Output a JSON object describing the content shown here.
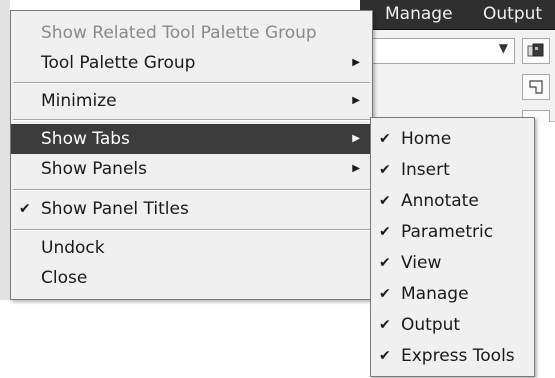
{
  "ribbon": {
    "tabs": [
      {
        "label": "Manage"
      },
      {
        "label": "Output"
      }
    ],
    "tool_icons": [
      "layers-icon",
      "corner-shape-icon",
      "tool-icon"
    ]
  },
  "menu": {
    "items": [
      {
        "label": "Show Related Tool Palette Group",
        "disabled": true
      },
      {
        "label": "Tool Palette Group",
        "has_submenu": true
      },
      {
        "label": "Minimize",
        "has_submenu": true
      },
      {
        "label": "Show Tabs",
        "has_submenu": true,
        "selected": true
      },
      {
        "label": "Show Panels",
        "has_submenu": true
      },
      {
        "label": "Show Panel Titles",
        "checked": true
      },
      {
        "label": "Undock"
      },
      {
        "label": "Close"
      }
    ],
    "check_glyph": "✔",
    "submenu_arrow_glyph": "▶"
  },
  "submenu": {
    "items": [
      {
        "label": "Home",
        "checked": true
      },
      {
        "label": "Insert",
        "checked": true
      },
      {
        "label": "Annotate",
        "checked": true
      },
      {
        "label": "Parametric",
        "checked": true
      },
      {
        "label": "View",
        "checked": true
      },
      {
        "label": "Manage",
        "checked": true
      },
      {
        "label": "Output",
        "checked": true
      },
      {
        "label": "Express Tools",
        "checked": true
      }
    ]
  },
  "colors": {
    "menu_background": "#f0f0f0",
    "selected_background": "#3c3c3c",
    "disabled_text": "#8a8a8a",
    "ribbon_dark": "#2f2f2f"
  }
}
